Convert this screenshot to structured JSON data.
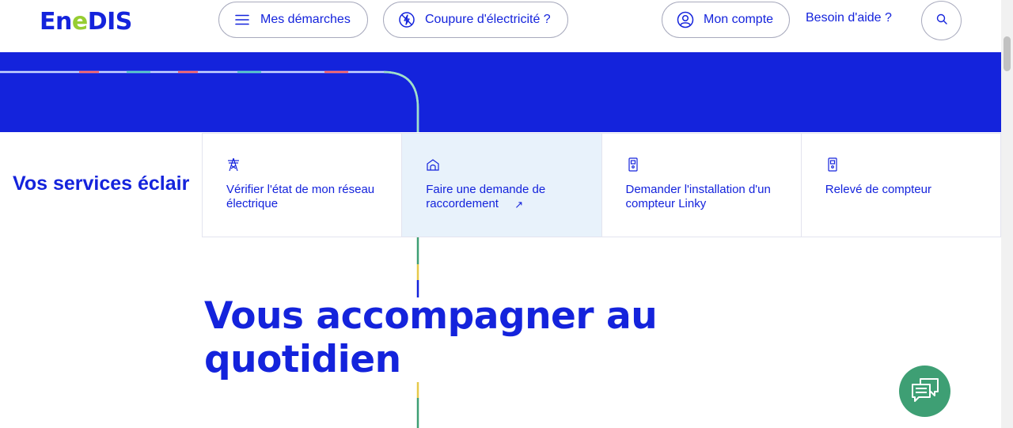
{
  "header": {
    "logo": {
      "part1": "En",
      "part2": "e",
      "part3": "DIS"
    },
    "nav": {
      "demarches_label": "Mes démarches",
      "coupure_label": "Coupure d'électricité ?",
      "compte_label": "Mon compte",
      "help_label": "Besoin d'aide ?"
    }
  },
  "services": {
    "title": "Vos services éclair",
    "cards": [
      {
        "label": "Vérifier l'état de mon réseau électrique",
        "icon": "pylon-icon"
      },
      {
        "label": "Faire une demande de raccordement",
        "icon": "house-icon",
        "external": "↗"
      },
      {
        "label": "Demander l'installation d'un compteur Linky",
        "icon": "meter-icon"
      },
      {
        "label": "Relevé de compteur",
        "icon": "meter-icon"
      }
    ]
  },
  "main": {
    "title_line1": "Vous accompagner au",
    "title_line2": "quotidien"
  },
  "colors": {
    "brand_blue": "#1423dc",
    "accent_green": "#96cd32",
    "chat_green": "#3e9f74",
    "active_card_bg": "#e8f2fb"
  }
}
